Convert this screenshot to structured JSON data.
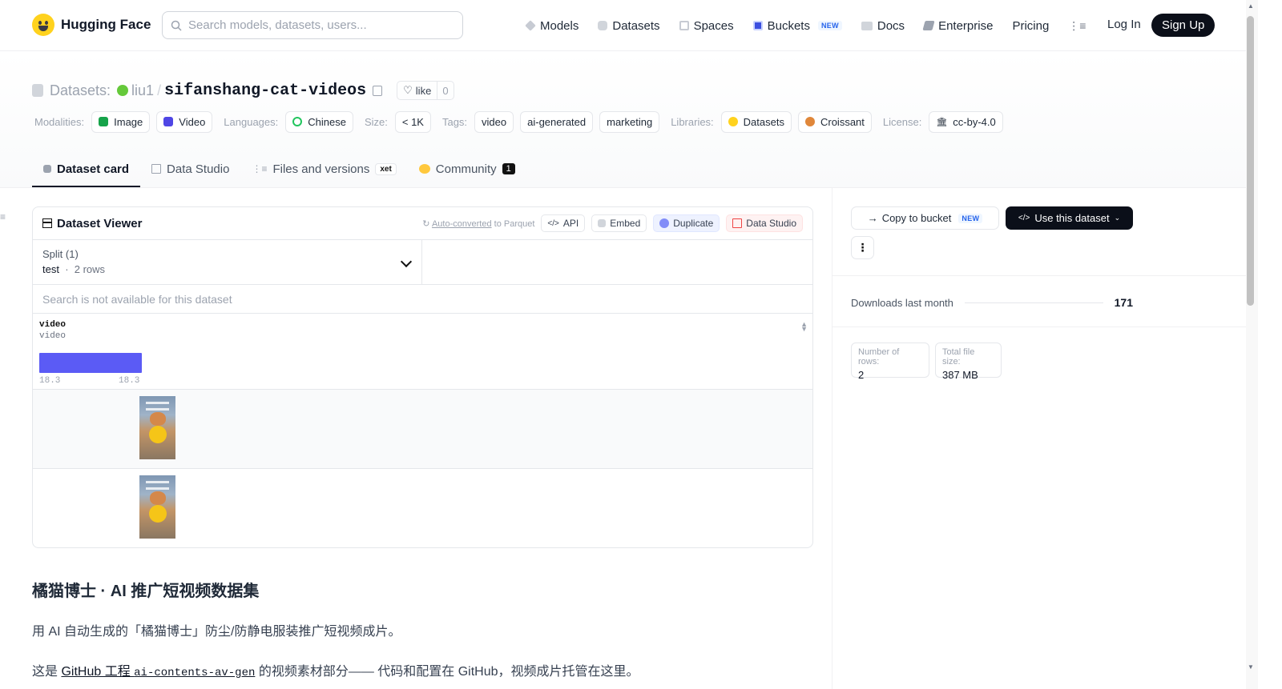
{
  "brand": {
    "name": "Hugging Face"
  },
  "search": {
    "placeholder": "Search models, datasets, users..."
  },
  "nav": {
    "items": [
      {
        "label": "Models",
        "icon": "model-icon"
      },
      {
        "label": "Datasets",
        "icon": "database-icon"
      },
      {
        "label": "Spaces",
        "icon": "spaces-icon"
      },
      {
        "label": "Buckets",
        "icon": "bucket-icon",
        "badge": "NEW"
      },
      {
        "label": "Docs",
        "icon": "book-icon"
      },
      {
        "label": "Enterprise",
        "icon": "enterprise-icon"
      },
      {
        "label": "Pricing"
      }
    ],
    "login": "Log In",
    "signup": "Sign Up"
  },
  "repo": {
    "type_label": "Datasets:",
    "owner": "liu1",
    "name": "sifanshang-cat-videos",
    "like_label": "like",
    "like_count": "0"
  },
  "tags": {
    "modalities_label": "Modalities:",
    "modalities": [
      "Image",
      "Video"
    ],
    "languages_label": "Languages:",
    "languages": [
      "Chinese"
    ],
    "size_label": "Size:",
    "size": "< 1K",
    "tags_label": "Tags:",
    "tags": [
      "video",
      "ai-generated",
      "marketing"
    ],
    "libraries_label": "Libraries:",
    "libraries": [
      "Datasets",
      "Croissant"
    ],
    "license_label": "License:",
    "license": "cc-by-4.0"
  },
  "tabs": [
    {
      "label": "Dataset card",
      "active": true
    },
    {
      "label": "Data Studio"
    },
    {
      "label": "Files and versions",
      "badge": "xet"
    },
    {
      "label": "Community",
      "count": "1"
    }
  ],
  "viewer": {
    "title": "Dataset Viewer",
    "auto_converted_prefix": "Auto-converted",
    "auto_converted_suffix": " to Parquet",
    "buttons": {
      "api": "API",
      "embed": "Embed",
      "duplicate": "Duplicate",
      "studio": "Data Studio"
    },
    "split_label": "Split (1)",
    "split_name": "test",
    "split_rows": "2 rows",
    "search_disabled": "Search is not available for this dataset",
    "column": {
      "name": "video",
      "type": "video",
      "hist_min": "18.3",
      "hist_max": "18.3"
    },
    "rows": [
      {
        "thumbnail": "cat-video-thumbnail"
      },
      {
        "thumbnail": "cat-video-thumbnail"
      }
    ]
  },
  "sidebar": {
    "copy_bucket": "Copy to bucket",
    "copy_bucket_badge": "NEW",
    "use_dataset": "Use this dataset",
    "downloads_label": "Downloads last month",
    "downloads_value": "171",
    "rows_label": "Number of rows:",
    "rows_value": "2",
    "filesize_label": "Total file size:",
    "filesize_value": "387 MB"
  },
  "card": {
    "heading": "橘猫博士 · AI 推广短视频数据集",
    "para1": "用 AI 自动生成的「橘猫博士」防尘/防静电服装推广短视频成片。",
    "para2_prefix": "这是 ",
    "para2_link_text": "GitHub 工程 ",
    "para2_link_code": "ai-contents-av-gen",
    "para2_suffix": " 的视频素材部分—— 代码和配置在 GitHub，视频成片托管在这里。"
  },
  "colors": {
    "brand_yellow": "#ffd21e",
    "primary_dark": "#0b0f19",
    "histogram": "#5b5bf5",
    "org_dot": "#65c93a"
  }
}
